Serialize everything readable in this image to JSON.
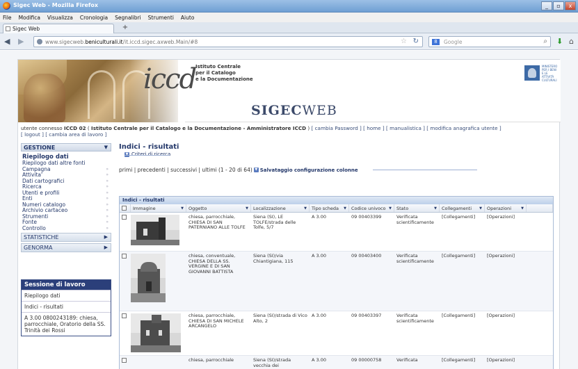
{
  "window": {
    "title": "Sigec Web - Mozilla Firefox",
    "buttons": [
      "_",
      "▫",
      "x"
    ]
  },
  "menubar": [
    "File",
    "Modifica",
    "Visualizza",
    "Cronologia",
    "Segnalibri",
    "Strumenti",
    "Aiuto"
  ],
  "tab": {
    "label": "Sigec Web",
    "new_tab": "+"
  },
  "nav": {
    "url_pre": "www.sigecweb.",
    "url_domain": "beniculturali.it",
    "url_post": "/it.iccd.sigec.axweb.Main/#8",
    "search_placeholder": "Google",
    "search_engine": "8"
  },
  "banner": {
    "logo": "iccd",
    "institute": [
      "Istituto Centrale",
      "per il Catalogo",
      "e la Documentazione"
    ],
    "app_name_bold": "SIGEC",
    "app_name_rest": "WEB",
    "ministry": [
      "MINISTERO",
      "PER I BENI",
      "E LE ATTIVITÀ",
      "CULTURALI"
    ]
  },
  "userline": {
    "prefix": "utente connesso ",
    "user": "ICCD 02",
    "org_open": " ( ",
    "org": "Istituto Centrale per il Catalogo e la Documentazione - Amministratore ICCD",
    "org_close": " ) ",
    "links": "[ cambia Password ] [ home ] [ manualistica ] [ modifica anagrafica utente ]",
    "line2": "[ logout ] [ cambia area di lavoro ]"
  },
  "sidebar": {
    "gestione": "GESTIONE",
    "riepilogo": "Riepilogo dati",
    "items": [
      "Riepilogo dati altre fonti",
      "Campagna",
      "Attivita'",
      "Dati cartografici",
      "Ricerca",
      "Utenti e profili",
      "Enti",
      "Numeri catalogo",
      "Archivio cartaceo",
      "Strumenti",
      "Fonte",
      "Controllo"
    ],
    "statistiche": "STATISTICHE",
    "genorma": "GENORMA"
  },
  "sessione": {
    "title": "Sessione di lavoro",
    "items": [
      "Riepilogo dati",
      "Indici - risultati",
      "A 3.00 0800243189: chiesa, parrocchiale, Oratorio della SS. Trinità dei Rossi"
    ]
  },
  "main": {
    "title": "Indici - risultati",
    "criteri": "Criteri di ricerca",
    "pager": "primi | precedenti | successivi | ultimi (1 - 20 di 64)",
    "save_columns": "Salvataggio configurazione colonne",
    "grid_title": "Indici - risultati",
    "columns": [
      "Immagine",
      "Oggetto",
      "Localizzazione",
      "Tipo scheda",
      "Codice univoco",
      "Stato",
      "Collegamenti",
      "Operazioni"
    ],
    "rows": [
      {
        "oggetto": "chiesa, parrocchiale, CHIESA DI SAN PATERNIANO ALLE TOLFE",
        "localizzazione": "Siena (SI), LE TOLFE/strada delle Tolfe, 5/7",
        "tipo": "A 3.00",
        "codice": "09 00403399",
        "stato": "Verificata scientificamente",
        "collegamenti": "[Collegamenti]",
        "operazioni": "[Operazioni]"
      },
      {
        "oggetto": "chiesa, conventuale, CHIESA DELLA SS. VERGINE E DI SAN GIOVANNI BATTISTA",
        "localizzazione": "Siena (SI)/via Chiantigiana, 115",
        "tipo": "A 3.00",
        "codice": "09 00403400",
        "stato": "Verificata scientificamente",
        "collegamenti": "[Collegamenti]",
        "operazioni": "[Operazioni]"
      },
      {
        "oggetto": "chiesa, parrocchiale, CHIESA DI SAN MICHELE ARCANGELO",
        "localizzazione": "Siena (SI)/strada di Vico Alto, 2",
        "tipo": "A 3.00",
        "codice": "09 00403397",
        "stato": "Verificata scientificamente",
        "collegamenti": "[Collegamenti]",
        "operazioni": "[Operazioni]"
      },
      {
        "oggetto": "chiesa, parrocchiale",
        "localizzazione": "Siena (SI)/strada vecchia dei",
        "tipo": "A 3.00",
        "codice": "09 00000758",
        "stato": "Verificata",
        "collegamenti": "[Collegamenti]",
        "operazioni": "[Operazioni]"
      }
    ]
  },
  "colors": {
    "navy": "#24386a",
    "session_header": "#2b3f7a"
  }
}
